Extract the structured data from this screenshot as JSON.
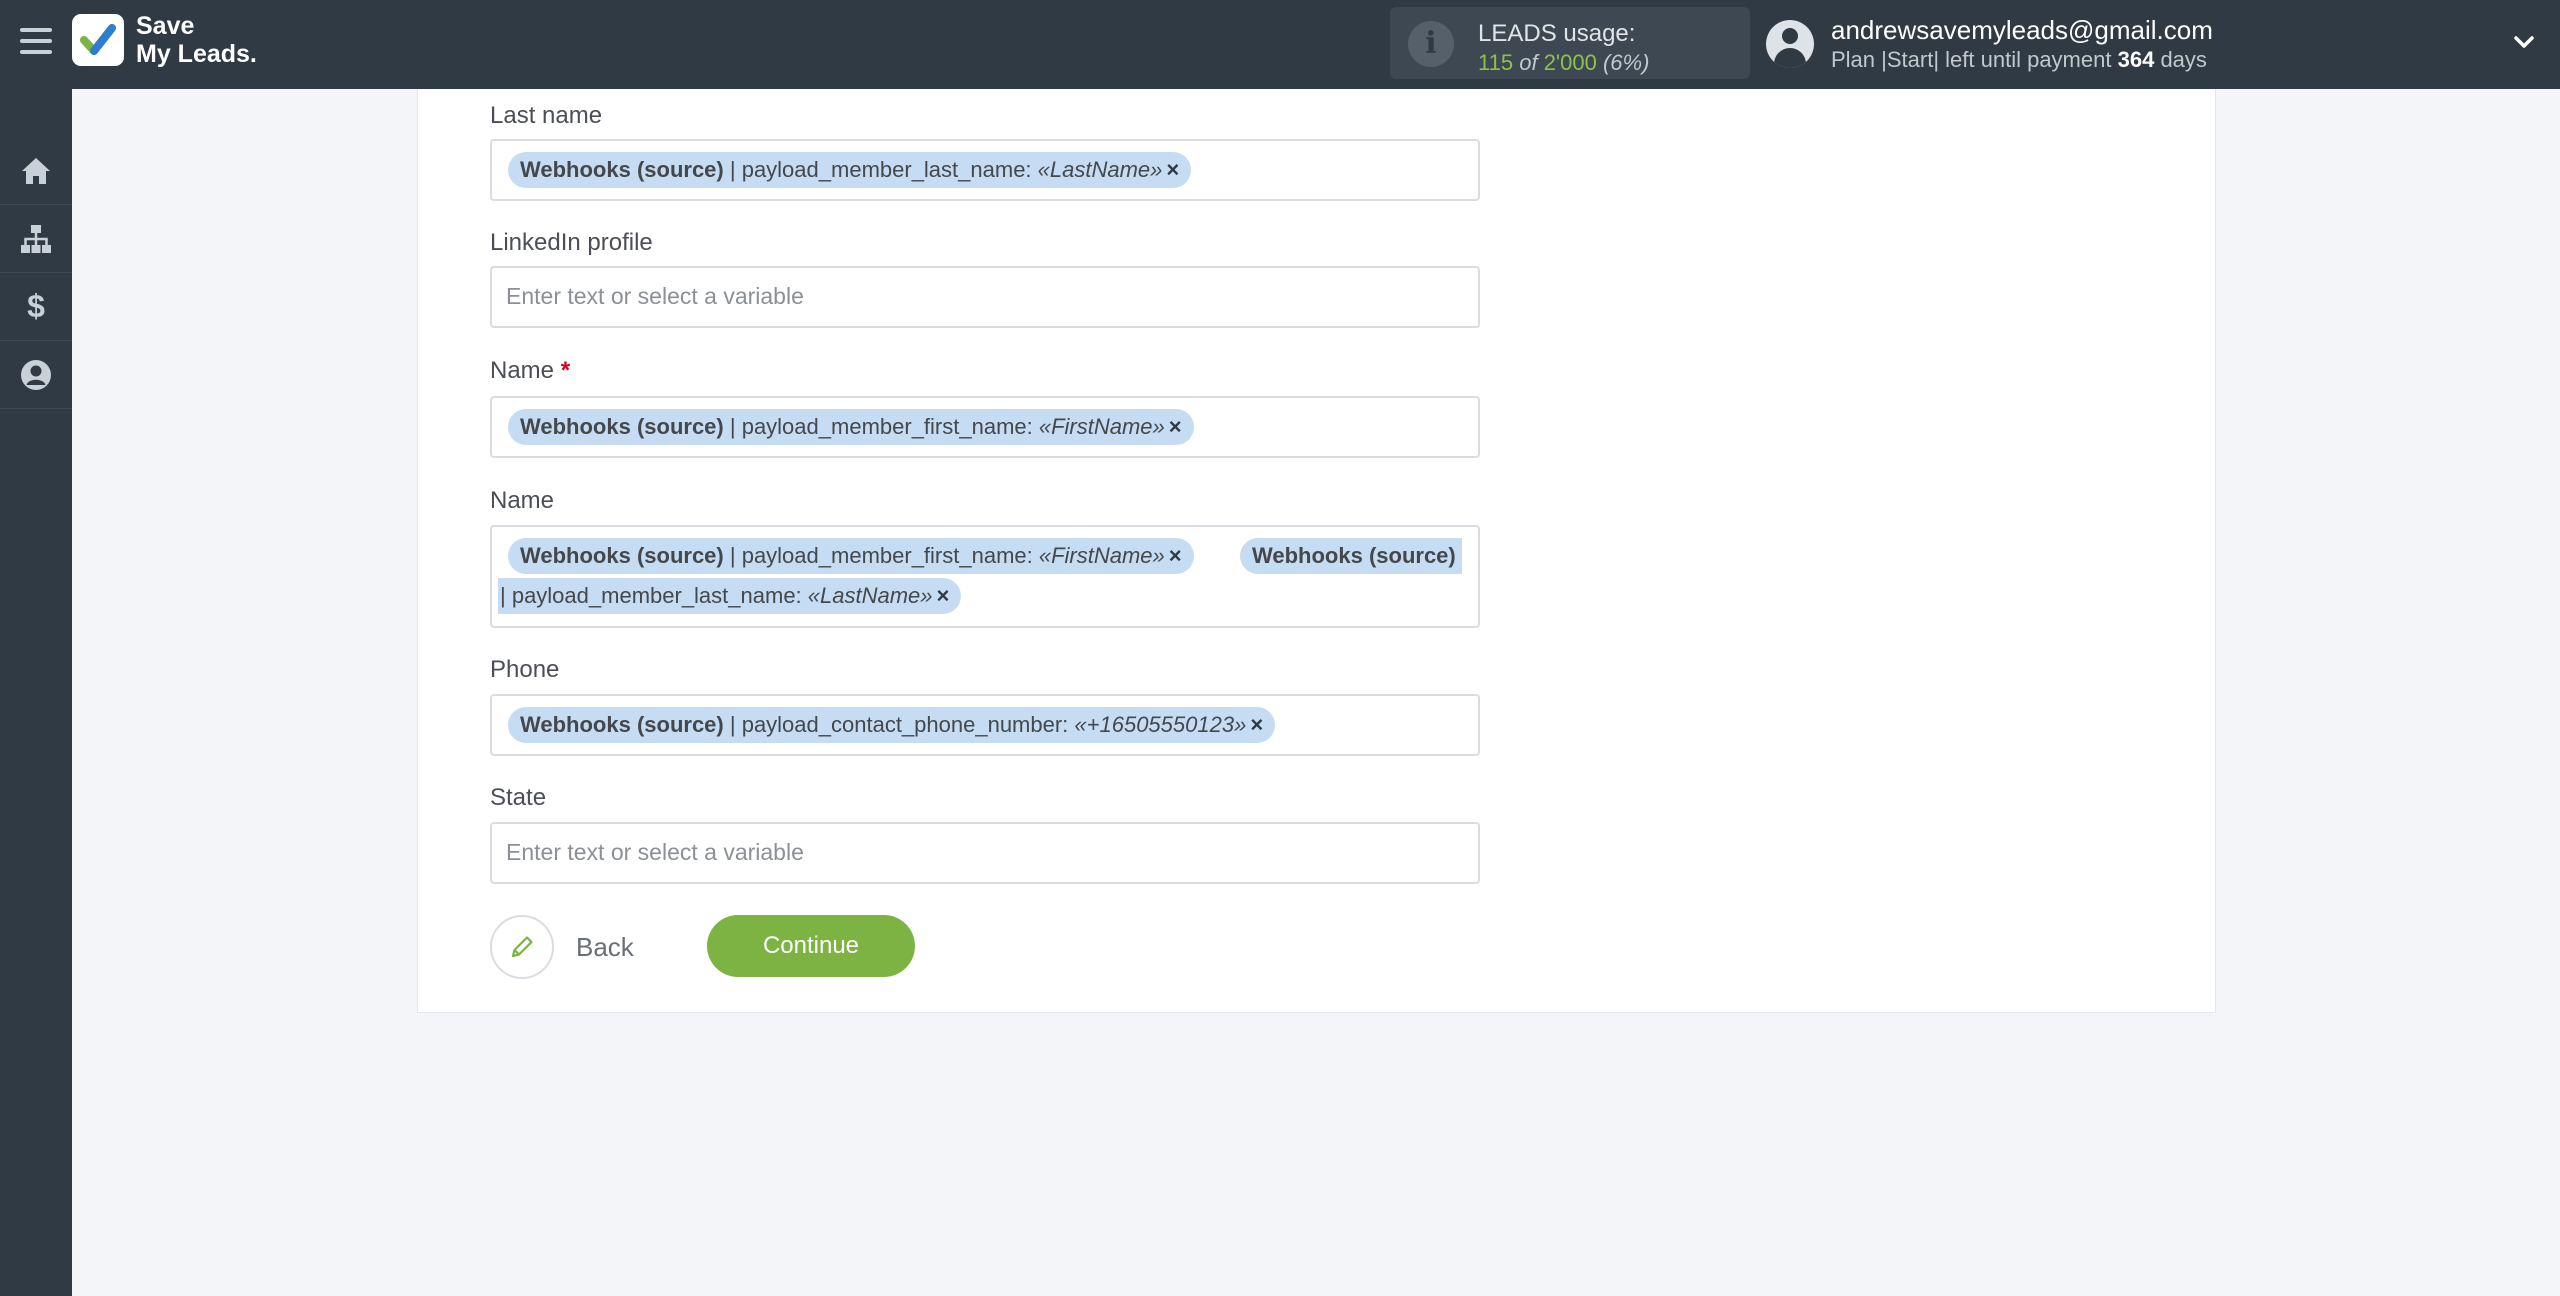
{
  "app": {
    "logo_line1": "Save",
    "logo_line2": "My Leads."
  },
  "usage": {
    "title": "LEADS usage:",
    "used": "115",
    "of": "of",
    "total": "2'000",
    "percent": "(6%)"
  },
  "user": {
    "email": "andrewsavemyleads@gmail.com",
    "plan_prefix": "Plan |Start| left until payment",
    "days": "364",
    "days_suffix": "days"
  },
  "sidebar": {
    "items": [
      {
        "icon": "home-icon"
      },
      {
        "icon": "sitemap-icon"
      },
      {
        "icon": "dollar-icon",
        "glyph": "$"
      },
      {
        "icon": "user-circle-icon"
      }
    ]
  },
  "fields": {
    "last_name": {
      "label": "Last name",
      "chip": {
        "source": "Webhooks (source)",
        "sep": " | ",
        "field": "payload_member_last_name: ",
        "value": "«LastName»",
        "remove": "×"
      }
    },
    "linkedin": {
      "label": "LinkedIn profile",
      "placeholder": "Enter text or select a variable"
    },
    "name_required": {
      "label": "Name",
      "required_mark": "*",
      "chip": {
        "source": "Webhooks (source)",
        "sep": " | ",
        "field": "payload_member_first_name: ",
        "value": "«FirstName»",
        "remove": "×"
      }
    },
    "name_full": {
      "label": "Name",
      "chip1": {
        "source": "Webhooks (source)",
        "sep": " | ",
        "field": "payload_member_first_name: ",
        "value": "«FirstName»",
        "remove": "×"
      },
      "chip2": {
        "source": "Webhooks (source)",
        "sep": "| ",
        "field": "payload_member_last_name: ",
        "value": "«LastName»",
        "remove": "×"
      }
    },
    "phone": {
      "label": "Phone",
      "chip": {
        "source": "Webhooks (source)",
        "sep": " | ",
        "field": "payload_contact_phone_number: ",
        "value": "«+16505550123»",
        "remove": "×"
      }
    },
    "state": {
      "label": "State",
      "placeholder": "Enter text or select a variable"
    }
  },
  "actions": {
    "back": "Back",
    "continue": "Continue"
  },
  "colors": {
    "topbar": "#2f3a44",
    "accent_green": "#7cb342",
    "chip_bg": "#c6dcf2",
    "required_red": "#d0021b"
  }
}
